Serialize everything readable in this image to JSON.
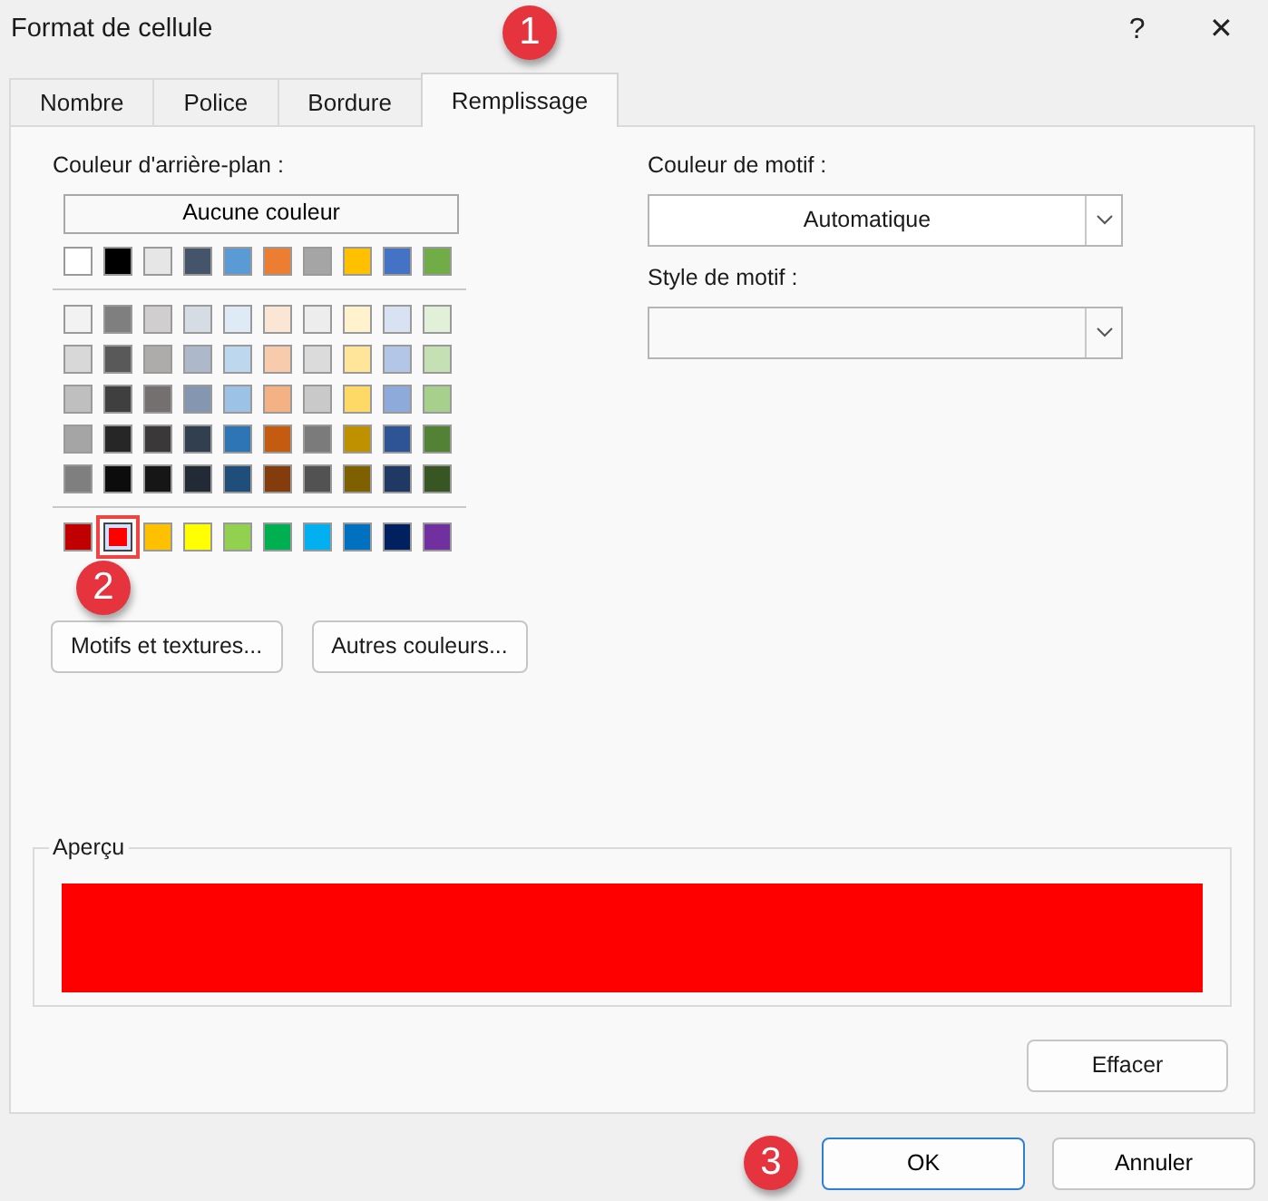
{
  "window": {
    "title": "Format de cellule",
    "help": "?",
    "close": "✕"
  },
  "tabs": [
    {
      "label": "Nombre",
      "selected": false
    },
    {
      "label": "Police",
      "selected": false
    },
    {
      "label": "Bordure",
      "selected": false
    },
    {
      "label": "Remplissage",
      "selected": true
    }
  ],
  "background": {
    "label": "Couleur d'arrière-plan :",
    "no_color_button": "Aucune couleur",
    "theme_colors": [
      {
        "color": "#ffffff",
        "selected": false
      },
      {
        "color": "#000000",
        "selected": false
      },
      {
        "color": "#e7e6e6",
        "selected": false
      },
      {
        "color": "#44546a",
        "selected": false
      },
      {
        "color": "#5b9bd5",
        "selected": false
      },
      {
        "color": "#ed7d31",
        "selected": false
      },
      {
        "color": "#a5a5a5",
        "selected": false
      },
      {
        "color": "#ffc000",
        "selected": false
      },
      {
        "color": "#4472c4",
        "selected": false
      },
      {
        "color": "#70ad47",
        "selected": false
      }
    ],
    "shade_rows": [
      [
        {
          "color": "#f2f2f2",
          "selected": false
        },
        {
          "color": "#7f7f7f",
          "selected": false
        },
        {
          "color": "#d0cece",
          "selected": false
        },
        {
          "color": "#d6dce4",
          "selected": false
        },
        {
          "color": "#deebf6",
          "selected": false
        },
        {
          "color": "#fbe5d5",
          "selected": false
        },
        {
          "color": "#ededed",
          "selected": false
        },
        {
          "color": "#fff2cc",
          "selected": false
        },
        {
          "color": "#d9e2f3",
          "selected": false
        },
        {
          "color": "#e2efd9",
          "selected": false
        }
      ],
      [
        {
          "color": "#d8d8d8",
          "selected": false
        },
        {
          "color": "#595959",
          "selected": false
        },
        {
          "color": "#aeabab",
          "selected": false
        },
        {
          "color": "#adb9ca",
          "selected": false
        },
        {
          "color": "#bdd7ee",
          "selected": false
        },
        {
          "color": "#f7cbac",
          "selected": false
        },
        {
          "color": "#dbdbdb",
          "selected": false
        },
        {
          "color": "#fee599",
          "selected": false
        },
        {
          "color": "#b4c6e7",
          "selected": false
        },
        {
          "color": "#c5e0b3",
          "selected": false
        }
      ],
      [
        {
          "color": "#bfbfbf",
          "selected": false
        },
        {
          "color": "#3f3f3f",
          "selected": false
        },
        {
          "color": "#757070",
          "selected": false
        },
        {
          "color": "#8496b0",
          "selected": false
        },
        {
          "color": "#9cc3e5",
          "selected": false
        },
        {
          "color": "#f4b183",
          "selected": false
        },
        {
          "color": "#c9c9c9",
          "selected": false
        },
        {
          "color": "#ffd965",
          "selected": false
        },
        {
          "color": "#8eaadb",
          "selected": false
        },
        {
          "color": "#a8d08d",
          "selected": false
        }
      ],
      [
        {
          "color": "#a5a5a5",
          "selected": false
        },
        {
          "color": "#262626",
          "selected": false
        },
        {
          "color": "#3a3838",
          "selected": false
        },
        {
          "color": "#323f4f",
          "selected": false
        },
        {
          "color": "#2e75b5",
          "selected": false
        },
        {
          "color": "#c55a11",
          "selected": false
        },
        {
          "color": "#7b7b7b",
          "selected": false
        },
        {
          "color": "#bf9000",
          "selected": false
        },
        {
          "color": "#2f5496",
          "selected": false
        },
        {
          "color": "#538135",
          "selected": false
        }
      ],
      [
        {
          "color": "#7f7f7f",
          "selected": false
        },
        {
          "color": "#0c0c0c",
          "selected": false
        },
        {
          "color": "#171616",
          "selected": false
        },
        {
          "color": "#222a35",
          "selected": false
        },
        {
          "color": "#1e4e79",
          "selected": false
        },
        {
          "color": "#833c0b",
          "selected": false
        },
        {
          "color": "#525252",
          "selected": false
        },
        {
          "color": "#7f6000",
          "selected": false
        },
        {
          "color": "#1f3864",
          "selected": false
        },
        {
          "color": "#375623",
          "selected": false
        }
      ]
    ],
    "standard_colors": [
      {
        "color": "#c00000",
        "selected": false
      },
      {
        "color": "#ff0000",
        "selected": true
      },
      {
        "color": "#ffc000",
        "selected": false
      },
      {
        "color": "#ffff00",
        "selected": false
      },
      {
        "color": "#92d050",
        "selected": false
      },
      {
        "color": "#00b050",
        "selected": false
      },
      {
        "color": "#00b0f0",
        "selected": false
      },
      {
        "color": "#0070c0",
        "selected": false
      },
      {
        "color": "#002060",
        "selected": false
      },
      {
        "color": "#7030a0",
        "selected": false
      }
    ],
    "buttons": [
      "Motifs et textures...",
      "Autres couleurs..."
    ]
  },
  "pattern_color": {
    "label": "Couleur de motif :",
    "value": "Automatique"
  },
  "pattern_style": {
    "label": "Style de motif :"
  },
  "preview": {
    "label": "Aperçu",
    "color": "#ff0000"
  },
  "clear_button": "Effacer",
  "footer_buttons": [
    {
      "label": "OK",
      "default": true
    },
    {
      "label": "Annuler",
      "default": false
    }
  ],
  "annotations": [
    {
      "label": "1"
    },
    {
      "label": "2"
    },
    {
      "label": "3"
    }
  ]
}
